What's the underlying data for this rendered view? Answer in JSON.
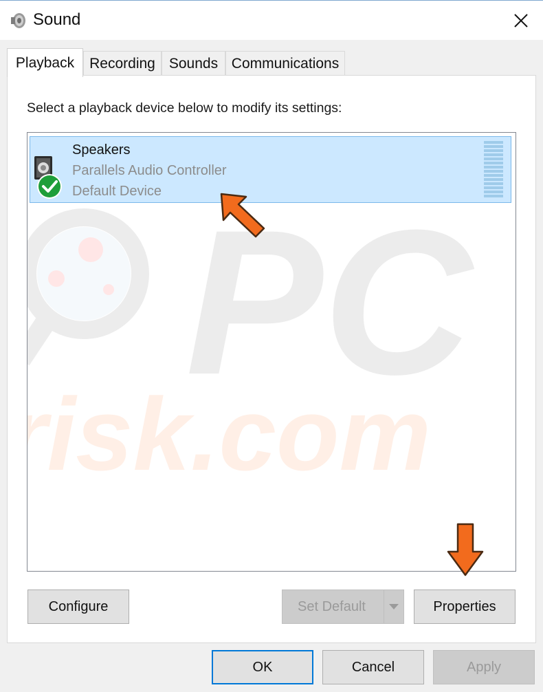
{
  "window": {
    "title": "Sound",
    "title_icon": "speaker-icon",
    "close_icon": "close-icon"
  },
  "tabs": [
    {
      "label": "Playback",
      "active": true
    },
    {
      "label": "Recording",
      "active": false
    },
    {
      "label": "Sounds",
      "active": false
    },
    {
      "label": "Communications",
      "active": false
    }
  ],
  "playback": {
    "instruction": "Select a playback device below to modify its settings:",
    "devices": [
      {
        "name": "Speakers",
        "controller": "Parallels Audio Controller",
        "status": "Default Device",
        "icon": "speaker-icon",
        "badge_icon": "checkmark-icon",
        "selected": true
      }
    ],
    "watermark": {
      "top": "PC",
      "bottom": "risk.com"
    },
    "buttons": {
      "configure": "Configure",
      "set_default": "Set Default",
      "properties": "Properties"
    }
  },
  "footer": {
    "ok": "OK",
    "cancel": "Cancel",
    "apply": "Apply"
  },
  "colors": {
    "selection_bg": "#cce8ff",
    "selection_border": "#7ab8ea",
    "accent": "#0078d7",
    "annotation_arrow": "#f26b1d",
    "check_green": "#1e9e3a"
  }
}
